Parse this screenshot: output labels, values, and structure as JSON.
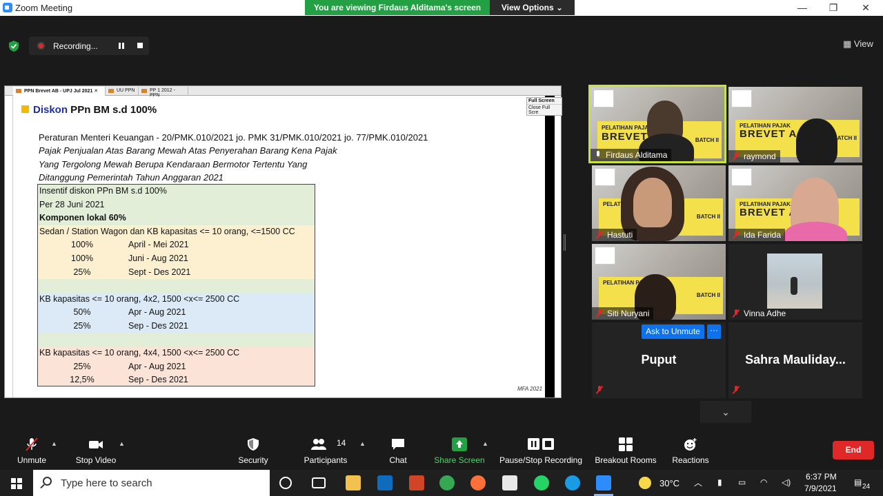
{
  "window": {
    "title": "Zoom Meeting",
    "viewing_banner": "You are viewing Firdaus Alditama's screen",
    "view_options": "View Options",
    "minimize": "—",
    "restore": "❐",
    "close": "✕"
  },
  "meeting_bar": {
    "recording_label": "Recording...",
    "view_label": "View"
  },
  "shared_screen": {
    "tabs": [
      "PPN Brevet AB - UPJ Jul 2021",
      "UU PPN",
      "PP 1 2012 - PPN"
    ],
    "full_screen": "Full Screen",
    "close_full_screen": "Close Full Scre",
    "heading_blue": "Diskon",
    "heading_rest": " PPn BM s.d 100%",
    "regulation": [
      "Peraturan Menteri Keuangan - 20/PMK.010/2021 jo. PMK 31/PMK.010/2021 jo. 77/PMK.010/2021",
      "Pajak Penjualan Atas Barang Mewah Atas Penyerahan Barang Kena Pajak",
      "Yang Tergolong Mewah Berupa Kendaraan Bermotor Tertentu Yang",
      "Ditanggung Pemerintah Tahun Anggaran 2021"
    ],
    "table": {
      "intro": [
        "Insentif diskon PPn BM s.d 100%",
        "Per 28 Juni 2021",
        "Komponen lokal 60%"
      ],
      "group1_title": "Sedan / Station Wagon dan KB kapasitas <= 10 orang, <=1500 CC",
      "group1_rows": [
        {
          "pct": "100%",
          "period": "April - Mei 2021"
        },
        {
          "pct": "100%",
          "period": "Juni - Aug 2021"
        },
        {
          "pct": "25%",
          "period": "Sept - Des 2021"
        }
      ],
      "group2_title": "KB kapasitas <= 10 orang, 4x2, 1500 <x<= 2500 CC",
      "group2_rows": [
        {
          "pct": "50%",
          "period": "Apr - Aug 2021"
        },
        {
          "pct": "25%",
          "period": "Sep - Des 2021"
        }
      ],
      "group3_title": "KB kapasitas <= 10 orang, 4x4, 1500 <x<= 2500 CC",
      "group3_rows": [
        {
          "pct": "25%",
          "period": "Apr - Aug 2021"
        },
        {
          "pct": "12,5%",
          "period": "Sep - Des 2021"
        }
      ]
    },
    "footer": "MFA 2021"
  },
  "participants": {
    "tiles": [
      {
        "name": "Firdaus Alditama",
        "muted": false
      },
      {
        "name": "raymond",
        "muted": true
      },
      {
        "name": "Hastuti",
        "muted": true
      },
      {
        "name": "Ida Farida",
        "muted": true
      },
      {
        "name": "Siti Nuryani",
        "muted": true
      },
      {
        "name": "Vinna Adhe",
        "muted": true
      }
    ],
    "band_small": "PELATIHAN PAJAK",
    "band_big": "BREVET A",
    "band_big_alt": "BREVET A&",
    "batch": "BATCH II",
    "name_tiles": [
      {
        "name": "Puput"
      },
      {
        "name": "Sahra  Mauliday..."
      }
    ],
    "ask_unmute": "Ask to Unmute",
    "more": "···"
  },
  "toolbar": {
    "unmute": "Unmute",
    "stop_video": "Stop Video",
    "security": "Security",
    "participants": "Participants",
    "participants_count": "14",
    "chat": "Chat",
    "share_screen": "Share Screen",
    "pause_stop_recording": "Pause/Stop Recording",
    "breakout_rooms": "Breakout Rooms",
    "reactions": "Reactions",
    "end": "End"
  },
  "taskbar": {
    "search_placeholder": "Type here to search",
    "weather": "30°C",
    "time": "6:37 PM",
    "date": "7/9/2021",
    "notifications": "24"
  },
  "colors": {
    "share_green": "#23a043",
    "end_red": "#e02828",
    "active_speaker": "#c9e33c",
    "zoom_blue": "#0e72ed"
  }
}
